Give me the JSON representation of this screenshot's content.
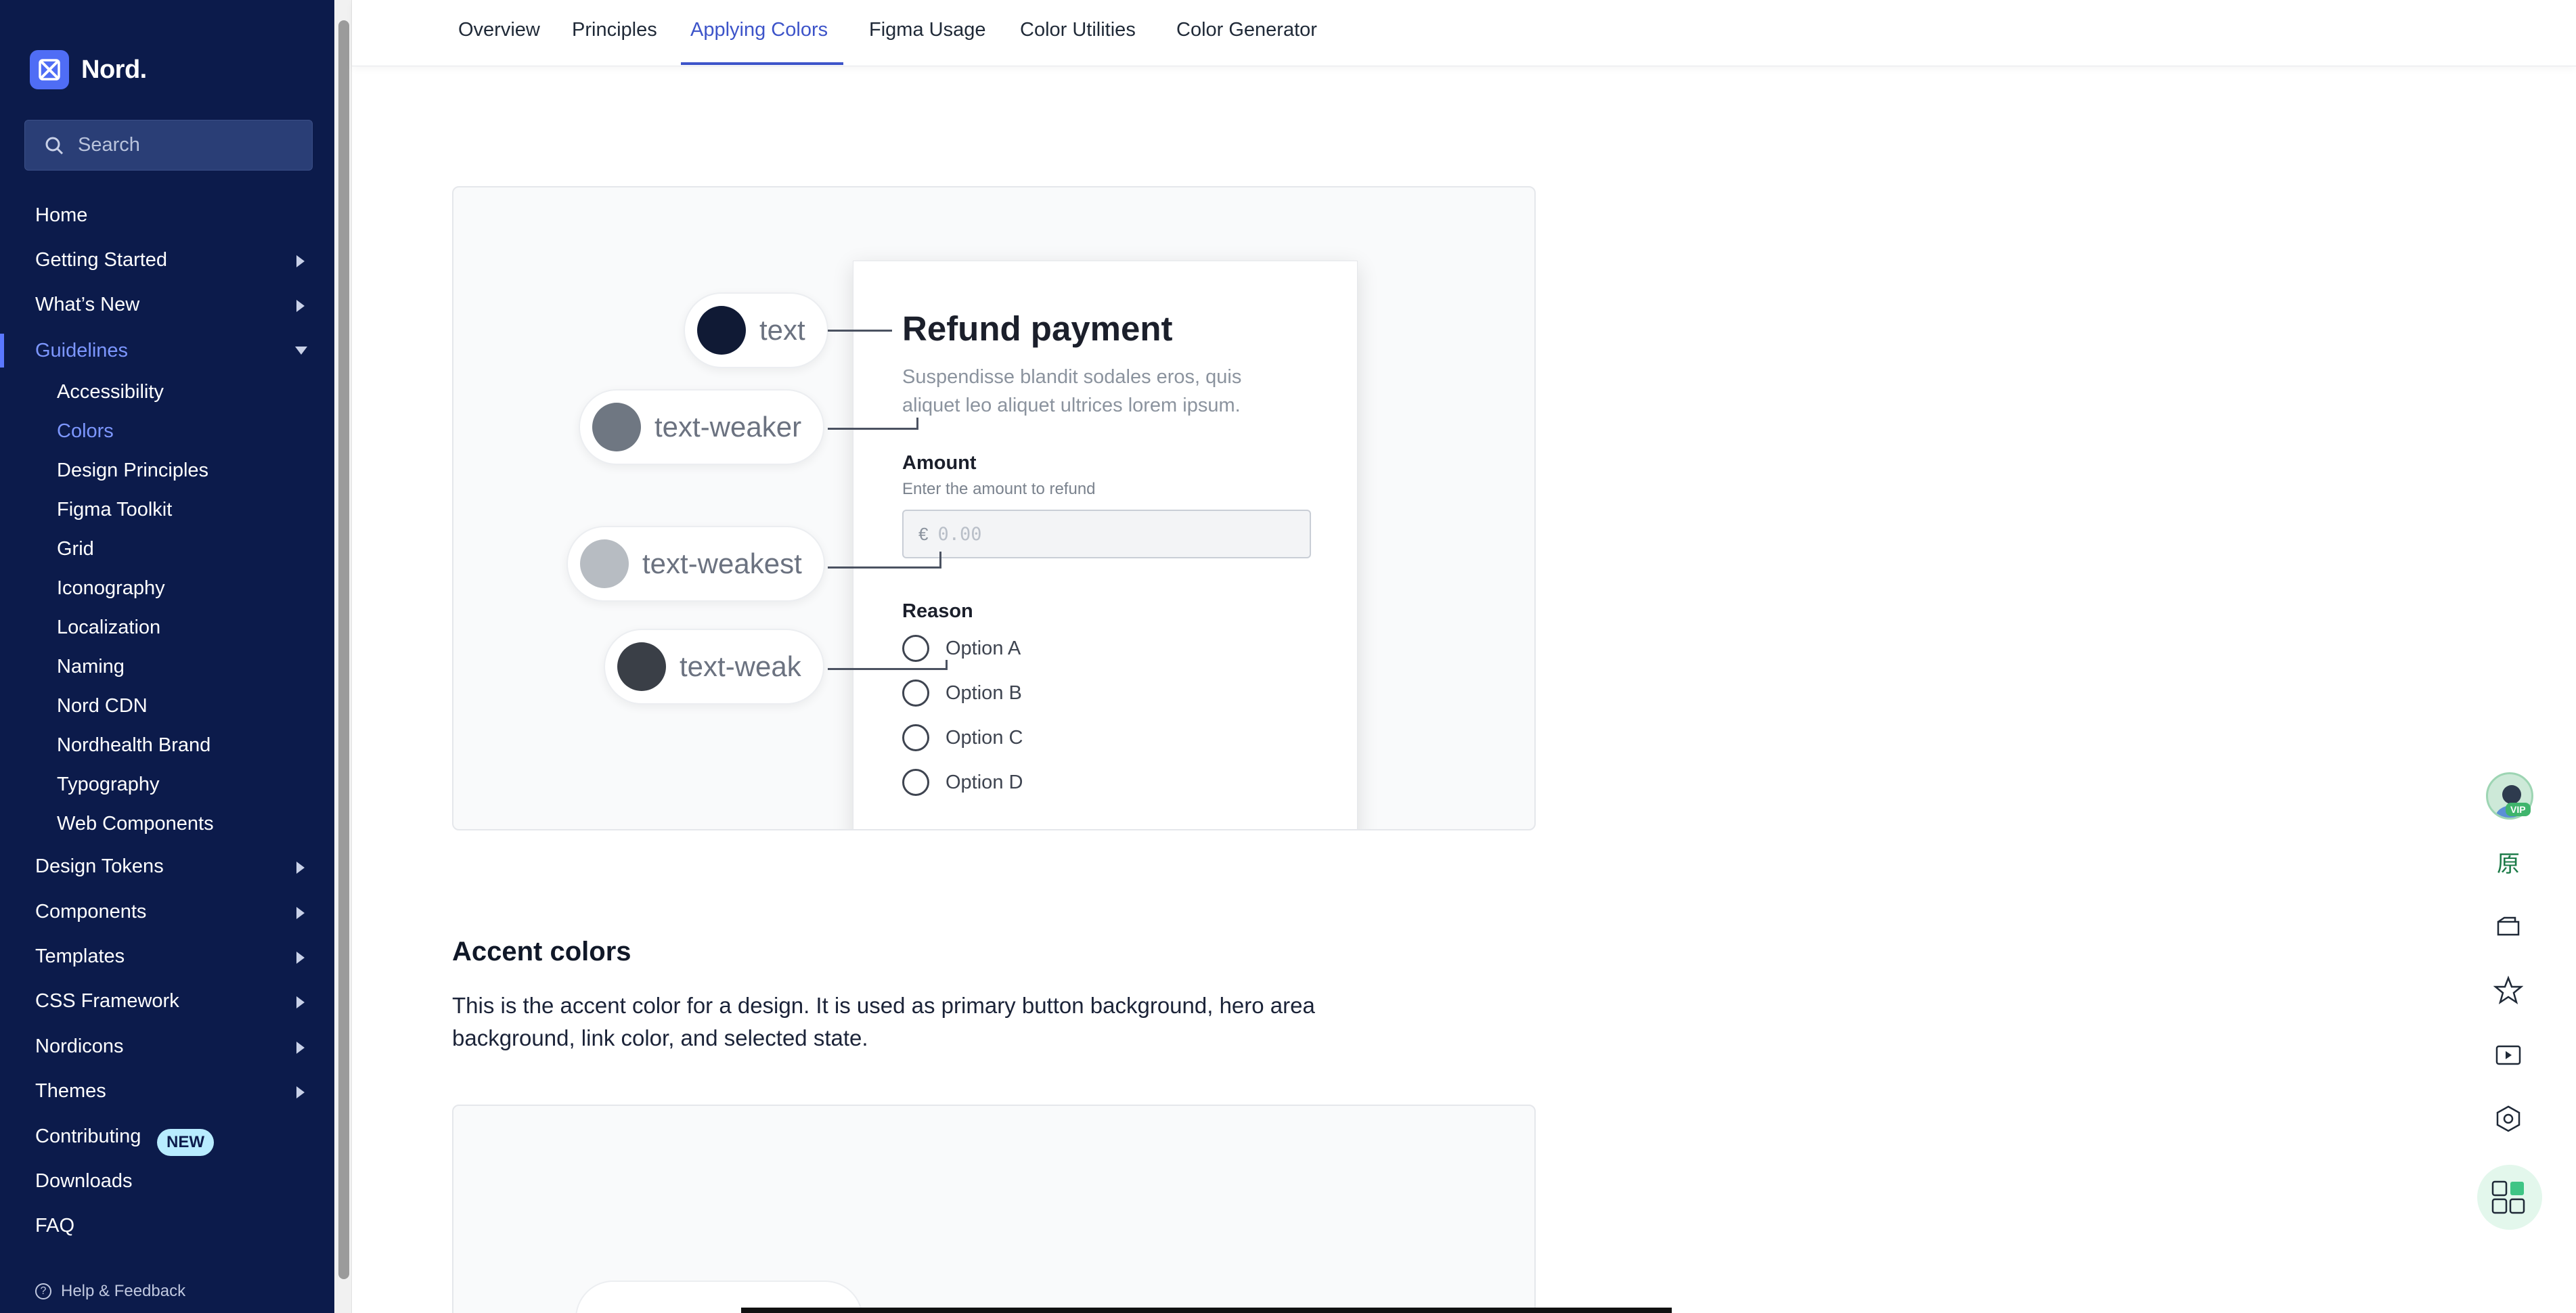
{
  "sidebar": {
    "brand": "Nord.",
    "search_placeholder": "Search",
    "items": {
      "home": "Home",
      "getting_started": "Getting Started",
      "whats_new": "What’s New",
      "guidelines": "Guidelines",
      "design_tokens": "Design Tokens",
      "components": "Components",
      "templates": "Templates",
      "css_framework": "CSS Framework",
      "nordicons": "Nordicons",
      "themes": "Themes",
      "contributing": "Contributing",
      "downloads": "Downloads",
      "faq": "FAQ"
    },
    "guidelines_sub": [
      "Accessibility",
      "Colors",
      "Design Principles",
      "Figma Toolkit",
      "Grid",
      "Iconography",
      "Localization",
      "Naming",
      "Nord CDN",
      "Nordhealth Brand",
      "Typography",
      "Web Components"
    ],
    "new_badge": "NEW",
    "help": "Help & Feedback"
  },
  "tabs": [
    "Overview",
    "Principles",
    "Applying Colors",
    "Figma Usage",
    "Color Utilities",
    "Color Generator"
  ],
  "demo": {
    "title": "Refund payment",
    "description": "Suspendisse blandit sodales eros, quis aliquet leo aliquet ultrices lorem ipsum.",
    "amount_label": "Amount",
    "amount_hint": "Enter the amount to refund",
    "currency": "€",
    "amount_placeholder": "0.00",
    "reason_label": "Reason",
    "options": [
      "Option A",
      "Option B",
      "Option C",
      "Option D"
    ],
    "tokens": [
      {
        "label": "text",
        "color": "#101a35"
      },
      {
        "label": "text-weaker",
        "color": "#6f7782"
      },
      {
        "label": "text-weakest",
        "color": "#b7bcc2"
      },
      {
        "label": "text-weak",
        "color": "#3a3f47"
      }
    ]
  },
  "accent": {
    "heading": "Accent colors",
    "paragraph": "This is the accent color for a design. It is used as primary button background, hero area background, link color, and selected state."
  },
  "tools": {
    "vip_badge": "VIP",
    "original_glyph": "原"
  },
  "colors": {
    "sidebar_bg": "#0c1b4b",
    "accent": "#3d54c9",
    "active_nav": "#7d97ff"
  }
}
